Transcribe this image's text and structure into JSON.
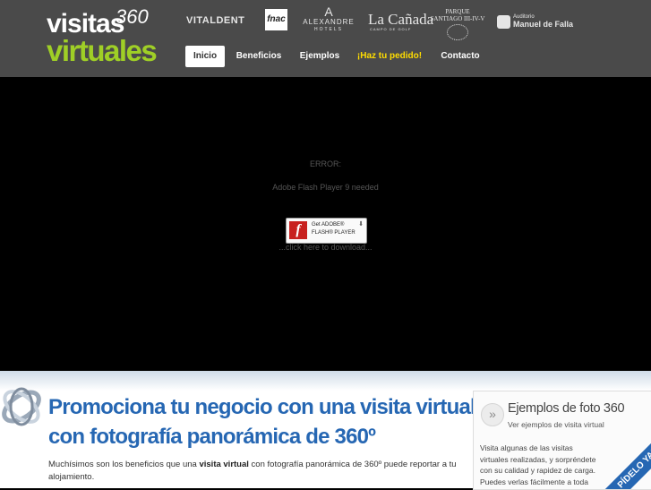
{
  "brand": {
    "line1": "visitas",
    "mark": "360",
    "line2": "virtuales"
  },
  "clients": {
    "vitaldent": "VITALDENT",
    "fnac": "fnac",
    "alexandre_mark": "A",
    "alexandre": "ALEXANDRE",
    "alexandre_sub": "HOTELS",
    "canada": "La Cañada",
    "canada_sub": "CAMPO DE GOLF",
    "parque_1": "PARQUE",
    "parque_2": "SANTIAGO III-IV-V",
    "falla_1": "Auditorio",
    "falla_2": "Manuel de Falla"
  },
  "nav": {
    "items": [
      {
        "label": "Inicio",
        "active": true
      },
      {
        "label": "Beneficios"
      },
      {
        "label": "Ejemplos"
      },
      {
        "label": "¡Haz tu pedido!",
        "accent": "#ffdd00"
      },
      {
        "label": "Contacto"
      }
    ]
  },
  "flash": {
    "error": "ERROR:",
    "message": "Adobe Flash Player 9 needed",
    "badge_line1": "Get ADOBE®",
    "badge_line2": "FLASH® PLAYER",
    "badge_icon": "f",
    "click_text": "...click here to download..."
  },
  "main": {
    "headline_line1": "Promociona tu negocio con una visita virtual",
    "headline_line2": "con fotografía panorámica de 360º",
    "intro_before": "Muchísimos son los beneficios que una ",
    "intro_bold": "visita virtual",
    "intro_after": " con fotografía panorámica de 360º puede reportar a tu alojamiento."
  },
  "sidebar": {
    "arrow": "»",
    "title": "Ejemplos de foto 360",
    "subtitle": "Ver ejemplos de visita virtual",
    "text": "Visita algunas de las visitas virtuales realizadas, y sorpréndete con su calidad y rapidez de carga. Puedes verlas fácilmente a toda",
    "ribbon": "PÍDELO YA!"
  },
  "colors": {
    "header_bg": "#4a4a4a",
    "brand_green": "#9fcf26",
    "headline_blue": "#2667b3",
    "nav_accent": "#ffdd00"
  }
}
